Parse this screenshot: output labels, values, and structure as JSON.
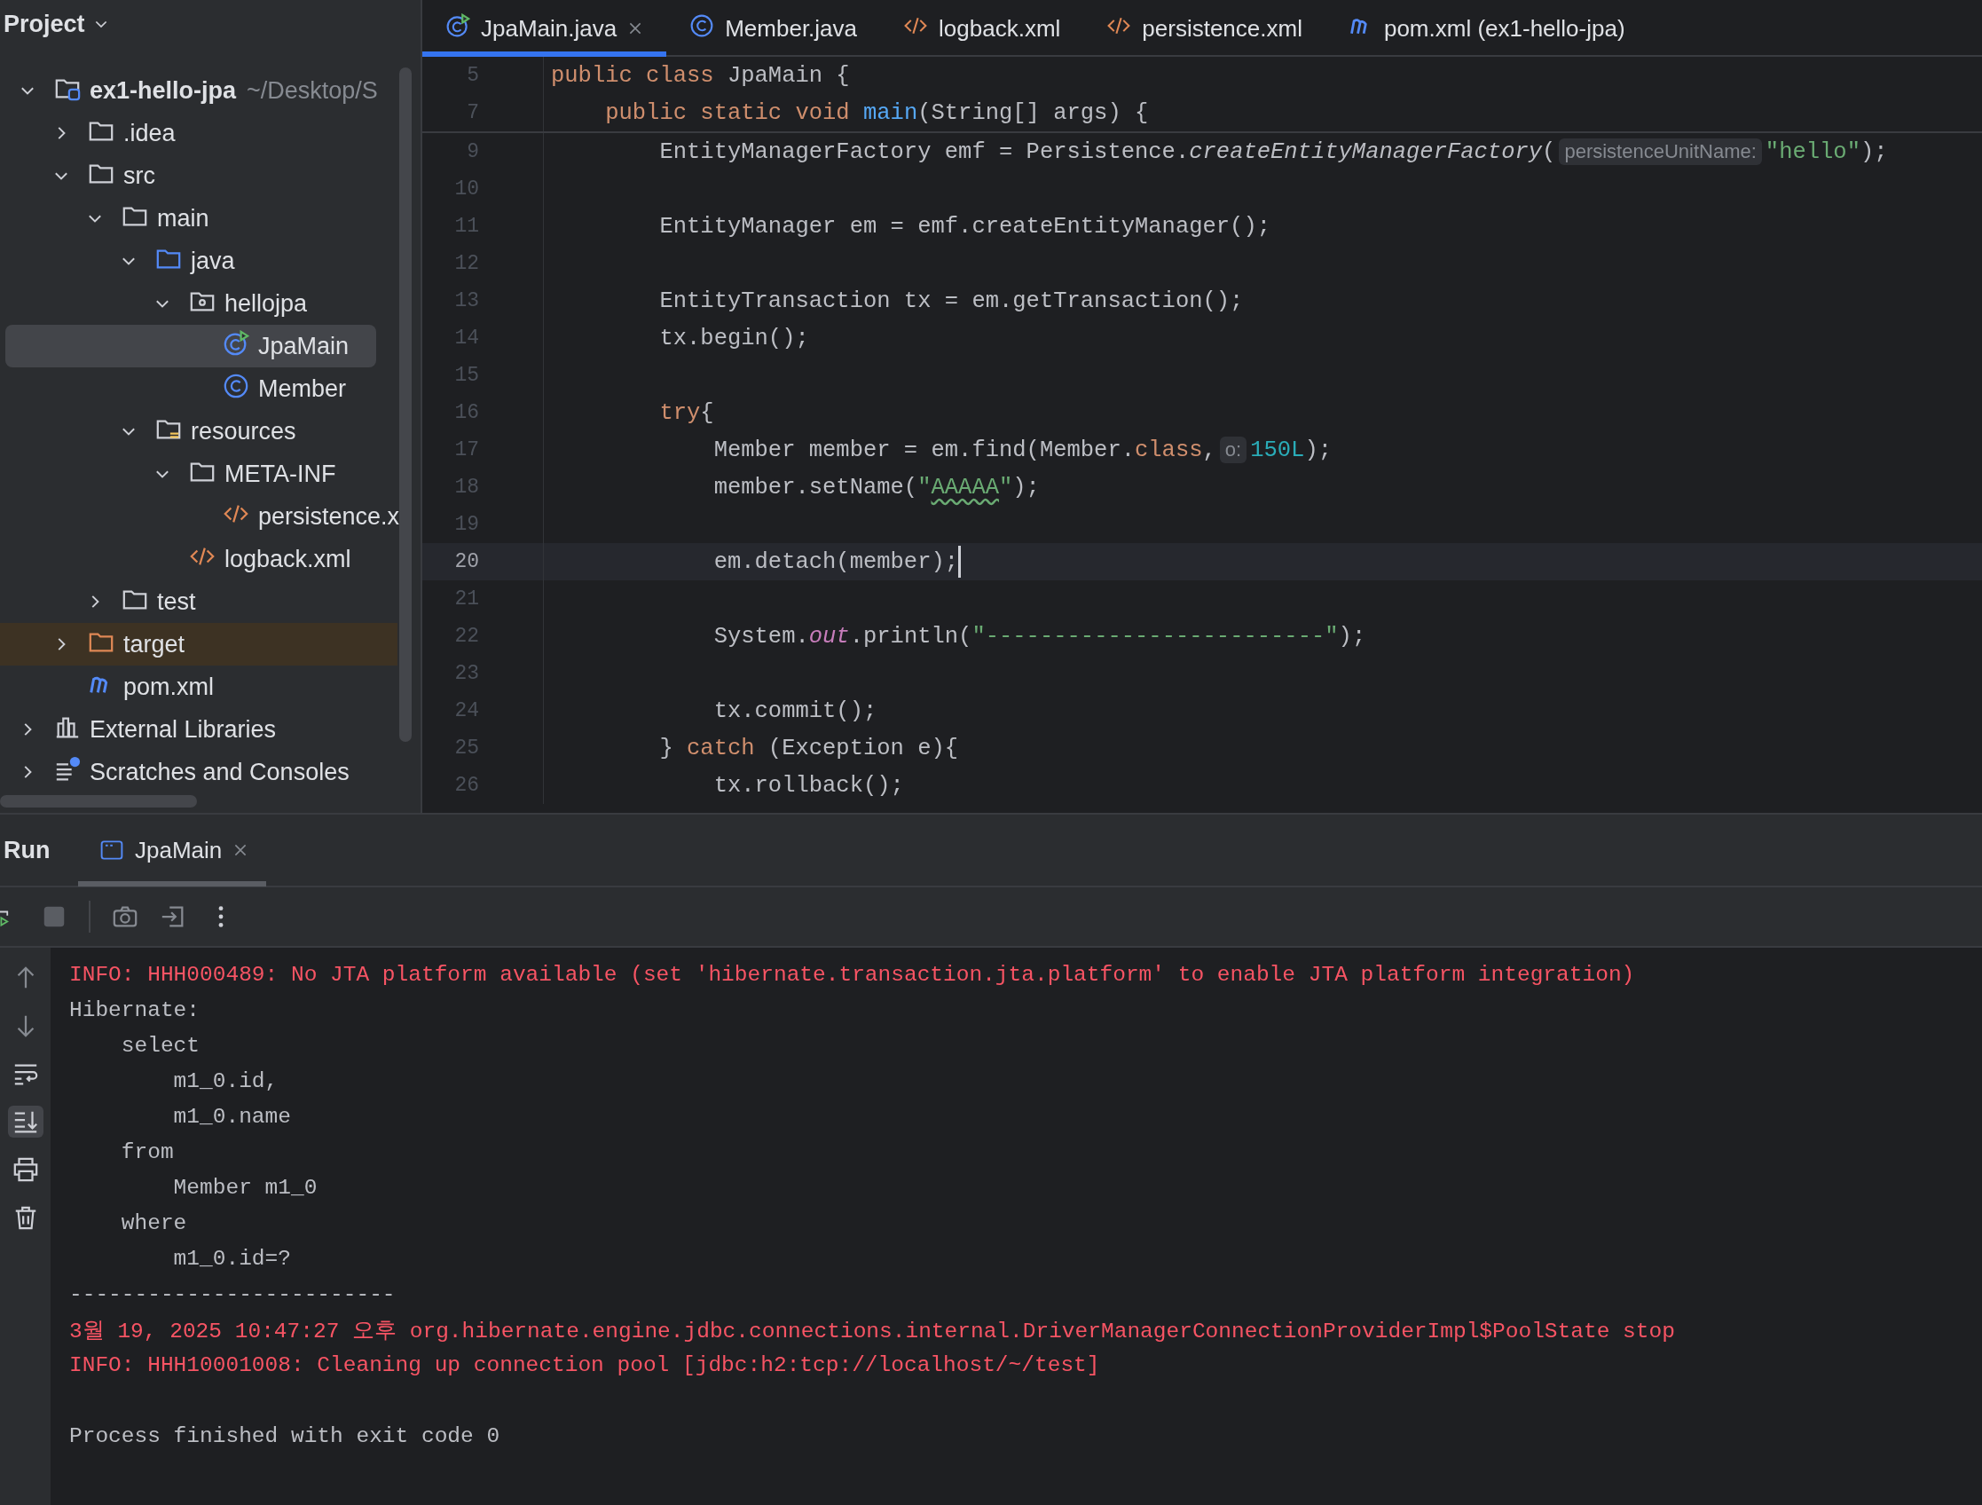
{
  "sidebar": {
    "title": "Project",
    "tree": [
      {
        "label": "ex1-hello-jpa",
        "path": "~/Desktop/S",
        "kind": "module",
        "expanded": true,
        "selected": false,
        "children": [
          {
            "label": ".idea",
            "kind": "folder",
            "expanded": false,
            "selected": false
          },
          {
            "label": "src",
            "kind": "folder",
            "expanded": true,
            "selected": false,
            "children": [
              {
                "label": "main",
                "kind": "folder",
                "expanded": true,
                "selected": false,
                "children": [
                  {
                    "label": "java",
                    "kind": "source-folder",
                    "expanded": true,
                    "selected": false,
                    "children": [
                      {
                        "label": "hellojpa",
                        "kind": "package",
                        "expanded": true,
                        "selected": false,
                        "children": [
                          {
                            "label": "JpaMain",
                            "kind": "main-class",
                            "selected": true
                          },
                          {
                            "label": "Member",
                            "kind": "class",
                            "selected": false
                          }
                        ]
                      }
                    ]
                  },
                  {
                    "label": "resources",
                    "kind": "resources-folder",
                    "expanded": true,
                    "selected": false,
                    "children": [
                      {
                        "label": "META-INF",
                        "kind": "folder",
                        "expanded": true,
                        "selected": false,
                        "children": [
                          {
                            "label": "persistence.x",
                            "kind": "xml",
                            "selected": false
                          }
                        ]
                      },
                      {
                        "label": "logback.xml",
                        "kind": "xml",
                        "selected": false
                      }
                    ]
                  }
                ]
              },
              {
                "label": "test",
                "kind": "folder",
                "expanded": false,
                "selected": false
              }
            ]
          },
          {
            "label": "target",
            "kind": "excluded-folder",
            "expanded": false,
            "selected": false
          },
          {
            "label": "pom.xml",
            "kind": "maven",
            "selected": false
          }
        ]
      },
      {
        "label": "External Libraries",
        "kind": "libraries",
        "expanded": false,
        "selected": false
      },
      {
        "label": "Scratches and Consoles",
        "kind": "scratches",
        "expanded": false,
        "selected": false
      }
    ]
  },
  "editor": {
    "tabs": [
      {
        "label": "JpaMain.java",
        "kind": "main-class",
        "selected": true,
        "closable": true
      },
      {
        "label": "Member.java",
        "kind": "class",
        "selected": false,
        "closable": false
      },
      {
        "label": "logback.xml",
        "kind": "xml",
        "selected": false,
        "closable": false
      },
      {
        "label": "persistence.xml",
        "kind": "xml",
        "selected": false,
        "closable": false
      },
      {
        "label": "pom.xml (ex1-hello-jpa)",
        "kind": "maven",
        "selected": false,
        "closable": false
      }
    ],
    "sticky_lines": [
      {
        "number": "5",
        "tokens": [
          {
            "text": "public class ",
            "kind": "keyword"
          },
          {
            "text": "JpaMain {",
            "kind": "plain"
          }
        ]
      },
      {
        "number": "7",
        "tokens": [
          {
            "text": "    public static void ",
            "kind": "keyword"
          },
          {
            "text": "main",
            "kind": "method"
          },
          {
            "text": "(String[] args) {",
            "kind": "plain"
          }
        ]
      }
    ],
    "lines": [
      {
        "number": "9",
        "current": false,
        "tokens": [
          {
            "text": "        EntityManagerFactory emf = Persistence.",
            "kind": "plain"
          },
          {
            "text": "createEntityManagerFactory",
            "kind": "static-method"
          },
          {
            "text": "(",
            "kind": "plain"
          },
          {
            "text": "persistenceUnitName:",
            "kind": "hint"
          },
          {
            "text": "\"hello\"",
            "kind": "string"
          },
          {
            "text": ");",
            "kind": "plain"
          }
        ]
      },
      {
        "number": "10",
        "current": false
      },
      {
        "number": "11",
        "current": false,
        "tokens": [
          {
            "text": "        EntityManager em = emf.createEntityManager();",
            "kind": "plain"
          }
        ]
      },
      {
        "number": "12",
        "current": false
      },
      {
        "number": "13",
        "current": false,
        "tokens": [
          {
            "text": "        EntityTransaction tx = em.getTransaction();",
            "kind": "plain"
          }
        ]
      },
      {
        "number": "14",
        "current": false,
        "tokens": [
          {
            "text": "        tx.begin();",
            "kind": "plain"
          }
        ]
      },
      {
        "number": "15",
        "current": false
      },
      {
        "number": "16",
        "current": false,
        "tokens": [
          {
            "text": "        try",
            "kind": "keyword"
          },
          {
            "text": "{",
            "kind": "plain"
          }
        ]
      },
      {
        "number": "17",
        "current": false,
        "tokens": [
          {
            "text": "            Member member = em.find(Member.",
            "kind": "plain"
          },
          {
            "text": "class",
            "kind": "keyword"
          },
          {
            "text": ",",
            "kind": "plain"
          },
          {
            "text": "o:",
            "kind": "hint"
          },
          {
            "text": "150L",
            "kind": "number"
          },
          {
            "text": ");",
            "kind": "plain"
          }
        ]
      },
      {
        "number": "18",
        "current": false,
        "tokens": [
          {
            "text": "            member.setName(",
            "kind": "plain"
          },
          {
            "text": "\"",
            "kind": "string"
          },
          {
            "text": "AAAAA",
            "kind": "typo-string"
          },
          {
            "text": "\"",
            "kind": "string"
          },
          {
            "text": ");",
            "kind": "plain"
          }
        ]
      },
      {
        "number": "19",
        "current": false
      },
      {
        "number": "20",
        "current": true,
        "tokens": [
          {
            "text": "            em.detach(member);",
            "kind": "plain"
          }
        ]
      },
      {
        "number": "21",
        "current": false
      },
      {
        "number": "22",
        "current": false,
        "tokens": [
          {
            "text": "            System.",
            "kind": "plain"
          },
          {
            "text": "out",
            "kind": "static-field"
          },
          {
            "text": ".println(",
            "kind": "plain"
          },
          {
            "text": "\"-------------------------\"",
            "kind": "string"
          },
          {
            "text": ");",
            "kind": "plain"
          }
        ]
      },
      {
        "number": "23",
        "current": false
      },
      {
        "number": "24",
        "current": false,
        "tokens": [
          {
            "text": "            tx.commit();",
            "kind": "plain"
          }
        ]
      },
      {
        "number": "25",
        "current": false,
        "tokens": [
          {
            "text": "        } ",
            "kind": "plain"
          },
          {
            "text": "catch",
            "kind": "keyword"
          },
          {
            "text": " (Exception e){",
            "kind": "plain"
          }
        ]
      },
      {
        "number": "26",
        "current": false,
        "tokens": [
          {
            "text": "            tx.rollback();",
            "kind": "plain"
          }
        ]
      }
    ]
  },
  "run_panel": {
    "title": "Run",
    "tabs": [
      {
        "label": "JpaMain",
        "selected": true,
        "closable": true
      }
    ],
    "console": [
      {
        "kind": "error",
        "text": "INFO: HHH000489: No JTA platform available (set 'hibernate.transaction.jta.platform' to enable JTA platform integration)"
      },
      {
        "kind": "plain",
        "text": "Hibernate: "
      },
      {
        "kind": "plain",
        "text": "    select"
      },
      {
        "kind": "plain",
        "text": "        m1_0.id,"
      },
      {
        "kind": "plain",
        "text": "        m1_0.name "
      },
      {
        "kind": "plain",
        "text": "    from"
      },
      {
        "kind": "plain",
        "text": "        Member m1_0 "
      },
      {
        "kind": "plain",
        "text": "    where"
      },
      {
        "kind": "plain",
        "text": "        m1_0.id=?"
      },
      {
        "kind": "plain",
        "text": "-------------------------"
      },
      {
        "kind": "error",
        "text": "3월 19, 2025 10:47:27 오후 org.hibernate.engine.jdbc.connections.internal.DriverManagerConnectionProviderImpl$PoolState stop"
      },
      {
        "kind": "error",
        "text": "INFO: HHH10001008: Cleaning up connection pool [jdbc:h2:tcp://localhost/~/test]"
      },
      {
        "kind": "blank"
      },
      {
        "kind": "plain",
        "text": "Process finished with exit code 0"
      }
    ]
  }
}
